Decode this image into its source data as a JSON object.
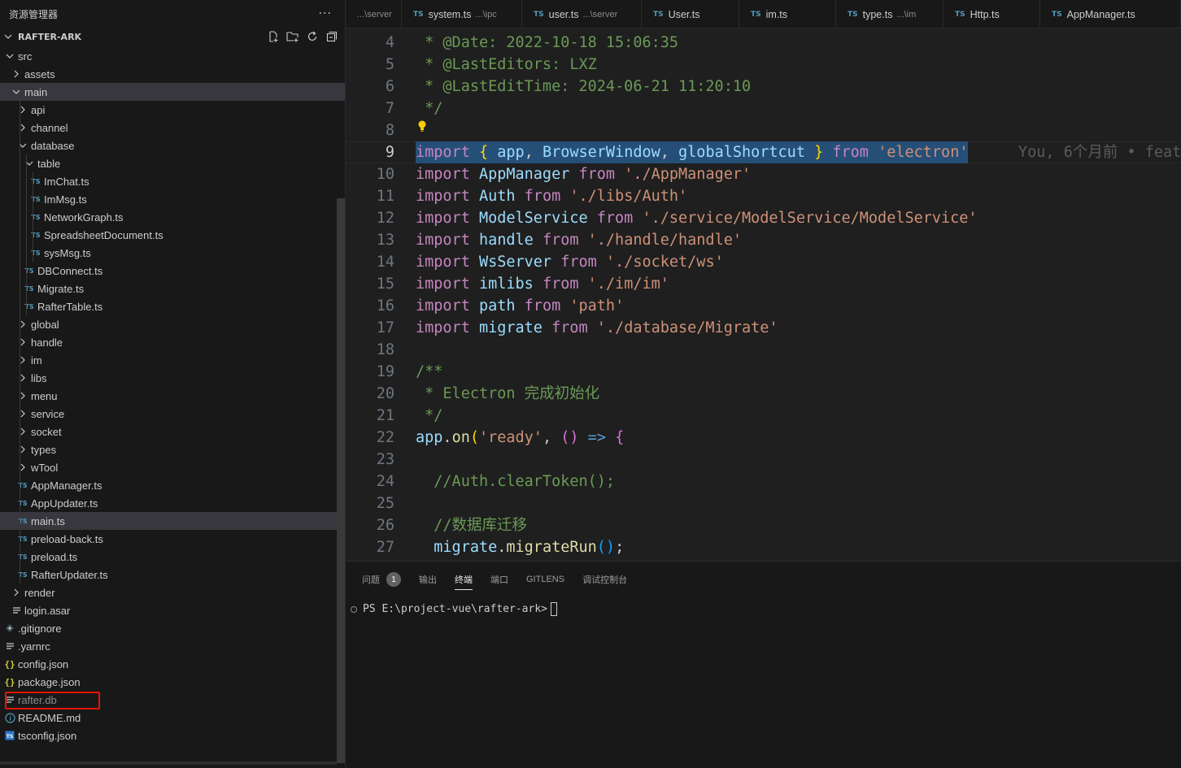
{
  "sidebar": {
    "title": "资源管理器",
    "more": "···",
    "project": "RAFTER-ARK",
    "tree": [
      {
        "label": "src",
        "kind": "folder",
        "open": true,
        "depth": 0
      },
      {
        "label": "assets",
        "kind": "folder",
        "open": false,
        "depth": 1
      },
      {
        "label": "main",
        "kind": "folder",
        "open": true,
        "depth": 1,
        "selected": true
      },
      {
        "label": "api",
        "kind": "folder",
        "open": false,
        "depth": 2
      },
      {
        "label": "channel",
        "kind": "folder",
        "open": false,
        "depth": 2
      },
      {
        "label": "database",
        "kind": "folder",
        "open": true,
        "depth": 2
      },
      {
        "label": "table",
        "kind": "folder",
        "open": true,
        "depth": 3
      },
      {
        "label": "ImChat.ts",
        "kind": "ts",
        "depth": 4
      },
      {
        "label": "ImMsg.ts",
        "kind": "ts",
        "depth": 4
      },
      {
        "label": "NetworkGraph.ts",
        "kind": "ts",
        "depth": 4
      },
      {
        "label": "SpreadsheetDocument.ts",
        "kind": "ts",
        "depth": 4
      },
      {
        "label": "sysMsg.ts",
        "kind": "ts",
        "depth": 4
      },
      {
        "label": "DBConnect.ts",
        "kind": "ts",
        "depth": 3
      },
      {
        "label": "Migrate.ts",
        "kind": "ts",
        "depth": 3
      },
      {
        "label": "RafterTable.ts",
        "kind": "ts",
        "depth": 3
      },
      {
        "label": "global",
        "kind": "folder",
        "open": false,
        "depth": 2
      },
      {
        "label": "handle",
        "kind": "folder",
        "open": false,
        "depth": 2
      },
      {
        "label": "im",
        "kind": "folder",
        "open": false,
        "depth": 2
      },
      {
        "label": "libs",
        "kind": "folder",
        "open": false,
        "depth": 2
      },
      {
        "label": "menu",
        "kind": "folder",
        "open": false,
        "depth": 2
      },
      {
        "label": "service",
        "kind": "folder",
        "open": false,
        "depth": 2
      },
      {
        "label": "socket",
        "kind": "folder",
        "open": false,
        "depth": 2
      },
      {
        "label": "types",
        "kind": "folder",
        "open": false,
        "depth": 2
      },
      {
        "label": "wTool",
        "kind": "folder",
        "open": false,
        "depth": 2
      },
      {
        "label": "AppManager.ts",
        "kind": "ts",
        "depth": 2
      },
      {
        "label": "AppUpdater.ts",
        "kind": "ts",
        "depth": 2
      },
      {
        "label": "main.ts",
        "kind": "ts",
        "depth": 2,
        "selected": true
      },
      {
        "label": "preload-back.ts",
        "kind": "ts",
        "depth": 2
      },
      {
        "label": "preload.ts",
        "kind": "ts",
        "depth": 2
      },
      {
        "label": "RafterUpdater.ts",
        "kind": "ts",
        "depth": 2
      },
      {
        "label": "render",
        "kind": "folder",
        "open": false,
        "depth": 1
      },
      {
        "label": "login.asar",
        "kind": "lines",
        "depth": 1
      },
      {
        "label": ".gitignore",
        "kind": "git",
        "depth": 0
      },
      {
        "label": ".yarnrc",
        "kind": "lines",
        "depth": 0
      },
      {
        "label": "config.json",
        "kind": "json",
        "depth": 0
      },
      {
        "label": "package.json",
        "kind": "json",
        "depth": 0
      },
      {
        "label": "rafter.db",
        "kind": "lines",
        "depth": 0,
        "faded": true
      },
      {
        "label": "README.md",
        "kind": "info",
        "depth": 0
      },
      {
        "label": "tsconfig.json",
        "kind": "tsconfig",
        "depth": 0
      }
    ]
  },
  "tabs": [
    {
      "icon": "",
      "name": "...\\server",
      "path": ""
    },
    {
      "icon": "TS",
      "name": "system.ts",
      "path": "...\\ipc"
    },
    {
      "icon": "TS",
      "name": "user.ts",
      "path": "...\\server"
    },
    {
      "icon": "TS",
      "name": "User.ts",
      "path": ""
    },
    {
      "icon": "TS",
      "name": "im.ts",
      "path": ""
    },
    {
      "icon": "TS",
      "name": "type.ts",
      "path": "...\\im"
    },
    {
      "icon": "TS",
      "name": "Http.ts",
      "path": ""
    },
    {
      "icon": "TS",
      "name": "AppManager.ts",
      "path": ""
    }
  ],
  "editor": {
    "current_line": 9,
    "blame": "You, 6个月前 • feat",
    "lines": [
      {
        "n": 4,
        "tokens": [
          [
            "pl",
            " "
          ],
          [
            "cm",
            "* @Date: 2022-10-18 15:06:35"
          ]
        ]
      },
      {
        "n": 5,
        "tokens": [
          [
            "pl",
            " "
          ],
          [
            "cm",
            "* @LastEditors: LXZ"
          ]
        ]
      },
      {
        "n": 6,
        "tokens": [
          [
            "pl",
            " "
          ],
          [
            "cm",
            "* @LastEditTime: 2024-06-21 11:20:10"
          ]
        ]
      },
      {
        "n": 7,
        "tokens": [
          [
            "pl",
            " "
          ],
          [
            "cm",
            "*/"
          ]
        ]
      },
      {
        "n": 8,
        "tokens": []
      },
      {
        "n": 9,
        "tokens": [
          [
            "kw",
            "import"
          ],
          [
            "pl",
            " "
          ],
          [
            "br1",
            "{"
          ],
          [
            "pl",
            " "
          ],
          [
            "id",
            "app"
          ],
          [
            "pl",
            ", "
          ],
          [
            "id",
            "BrowserWindow"
          ],
          [
            "pl",
            ", "
          ],
          [
            "id",
            "globalShortcut"
          ],
          [
            "pl",
            " "
          ],
          [
            "br1",
            "}"
          ],
          [
            "pl",
            " "
          ],
          [
            "kw",
            "from"
          ],
          [
            "pl",
            " "
          ],
          [
            "str",
            "'electron'"
          ]
        ],
        "selected": true
      },
      {
        "n": 10,
        "tokens": [
          [
            "kw",
            "import"
          ],
          [
            "pl",
            " "
          ],
          [
            "id",
            "AppManager"
          ],
          [
            "pl",
            " "
          ],
          [
            "kw",
            "from"
          ],
          [
            "pl",
            " "
          ],
          [
            "str",
            "'./AppManager'"
          ]
        ]
      },
      {
        "n": 11,
        "tokens": [
          [
            "kw",
            "import"
          ],
          [
            "pl",
            " "
          ],
          [
            "id",
            "Auth"
          ],
          [
            "pl",
            " "
          ],
          [
            "kw",
            "from"
          ],
          [
            "pl",
            " "
          ],
          [
            "str",
            "'./libs/Auth'"
          ]
        ]
      },
      {
        "n": 12,
        "tokens": [
          [
            "kw",
            "import"
          ],
          [
            "pl",
            " "
          ],
          [
            "id",
            "ModelService"
          ],
          [
            "pl",
            " "
          ],
          [
            "kw",
            "from"
          ],
          [
            "pl",
            " "
          ],
          [
            "str",
            "'./service/ModelService/ModelService'"
          ]
        ]
      },
      {
        "n": 13,
        "tokens": [
          [
            "kw",
            "import"
          ],
          [
            "pl",
            " "
          ],
          [
            "id",
            "handle"
          ],
          [
            "pl",
            " "
          ],
          [
            "kw",
            "from"
          ],
          [
            "pl",
            " "
          ],
          [
            "str",
            "'./handle/handle'"
          ]
        ]
      },
      {
        "n": 14,
        "tokens": [
          [
            "kw",
            "import"
          ],
          [
            "pl",
            " "
          ],
          [
            "id",
            "WsServer"
          ],
          [
            "pl",
            " "
          ],
          [
            "kw",
            "from"
          ],
          [
            "pl",
            " "
          ],
          [
            "str",
            "'./socket/ws'"
          ]
        ]
      },
      {
        "n": 15,
        "tokens": [
          [
            "kw",
            "import"
          ],
          [
            "pl",
            " "
          ],
          [
            "id",
            "imlibs"
          ],
          [
            "pl",
            " "
          ],
          [
            "kw",
            "from"
          ],
          [
            "pl",
            " "
          ],
          [
            "str",
            "'./im/im'"
          ]
        ]
      },
      {
        "n": 16,
        "tokens": [
          [
            "kw",
            "import"
          ],
          [
            "pl",
            " "
          ],
          [
            "id",
            "path"
          ],
          [
            "pl",
            " "
          ],
          [
            "kw",
            "from"
          ],
          [
            "pl",
            " "
          ],
          [
            "str",
            "'path'"
          ]
        ]
      },
      {
        "n": 17,
        "tokens": [
          [
            "kw",
            "import"
          ],
          [
            "pl",
            " "
          ],
          [
            "id",
            "migrate"
          ],
          [
            "pl",
            " "
          ],
          [
            "kw",
            "from"
          ],
          [
            "pl",
            " "
          ],
          [
            "str",
            "'./database/Migrate'"
          ]
        ]
      },
      {
        "n": 18,
        "tokens": []
      },
      {
        "n": 19,
        "tokens": [
          [
            "cm",
            "/**"
          ]
        ]
      },
      {
        "n": 20,
        "tokens": [
          [
            "pl",
            " "
          ],
          [
            "cm",
            "* Electron 完成初始化"
          ]
        ]
      },
      {
        "n": 21,
        "tokens": [
          [
            "pl",
            " "
          ],
          [
            "cm",
            "*/"
          ]
        ]
      },
      {
        "n": 22,
        "tokens": [
          [
            "id",
            "app"
          ],
          [
            "pl",
            "."
          ],
          [
            "fn",
            "on"
          ],
          [
            "br1",
            "("
          ],
          [
            "str",
            "'ready'"
          ],
          [
            "pl",
            ", "
          ],
          [
            "br2",
            "()"
          ],
          [
            "pl",
            " "
          ],
          [
            "arrow",
            "=>"
          ],
          [
            "pl",
            " "
          ],
          [
            "br2",
            "{"
          ]
        ]
      },
      {
        "n": 23,
        "tokens": []
      },
      {
        "n": 24,
        "tokens": [
          [
            "pl",
            "  "
          ],
          [
            "cm",
            "//Auth.clearToken();"
          ]
        ]
      },
      {
        "n": 25,
        "tokens": []
      },
      {
        "n": 26,
        "tokens": [
          [
            "pl",
            "  "
          ],
          [
            "cm",
            "//数据库迁移"
          ]
        ]
      },
      {
        "n": 27,
        "tokens": [
          [
            "pl",
            "  "
          ],
          [
            "id",
            "migrate"
          ],
          [
            "pl",
            "."
          ],
          [
            "fn",
            "migrateRun"
          ],
          [
            "br3",
            "()"
          ],
          [
            "pl",
            ";"
          ]
        ]
      }
    ]
  },
  "panel": {
    "tabs": [
      {
        "label": "问题",
        "badge": "1",
        "active": false
      },
      {
        "label": "输出",
        "active": false
      },
      {
        "label": "终端",
        "active": true
      },
      {
        "label": "端口",
        "active": false
      },
      {
        "label": "GITLENS",
        "active": false
      },
      {
        "label": "调试控制台",
        "active": false
      }
    ],
    "prompt": "PS E:\\project-vue\\rafter-ark>"
  },
  "colors": {
    "accent_selection": "#264f78",
    "highlight_box": "#e51400",
    "ts_icon": "#519aba"
  }
}
